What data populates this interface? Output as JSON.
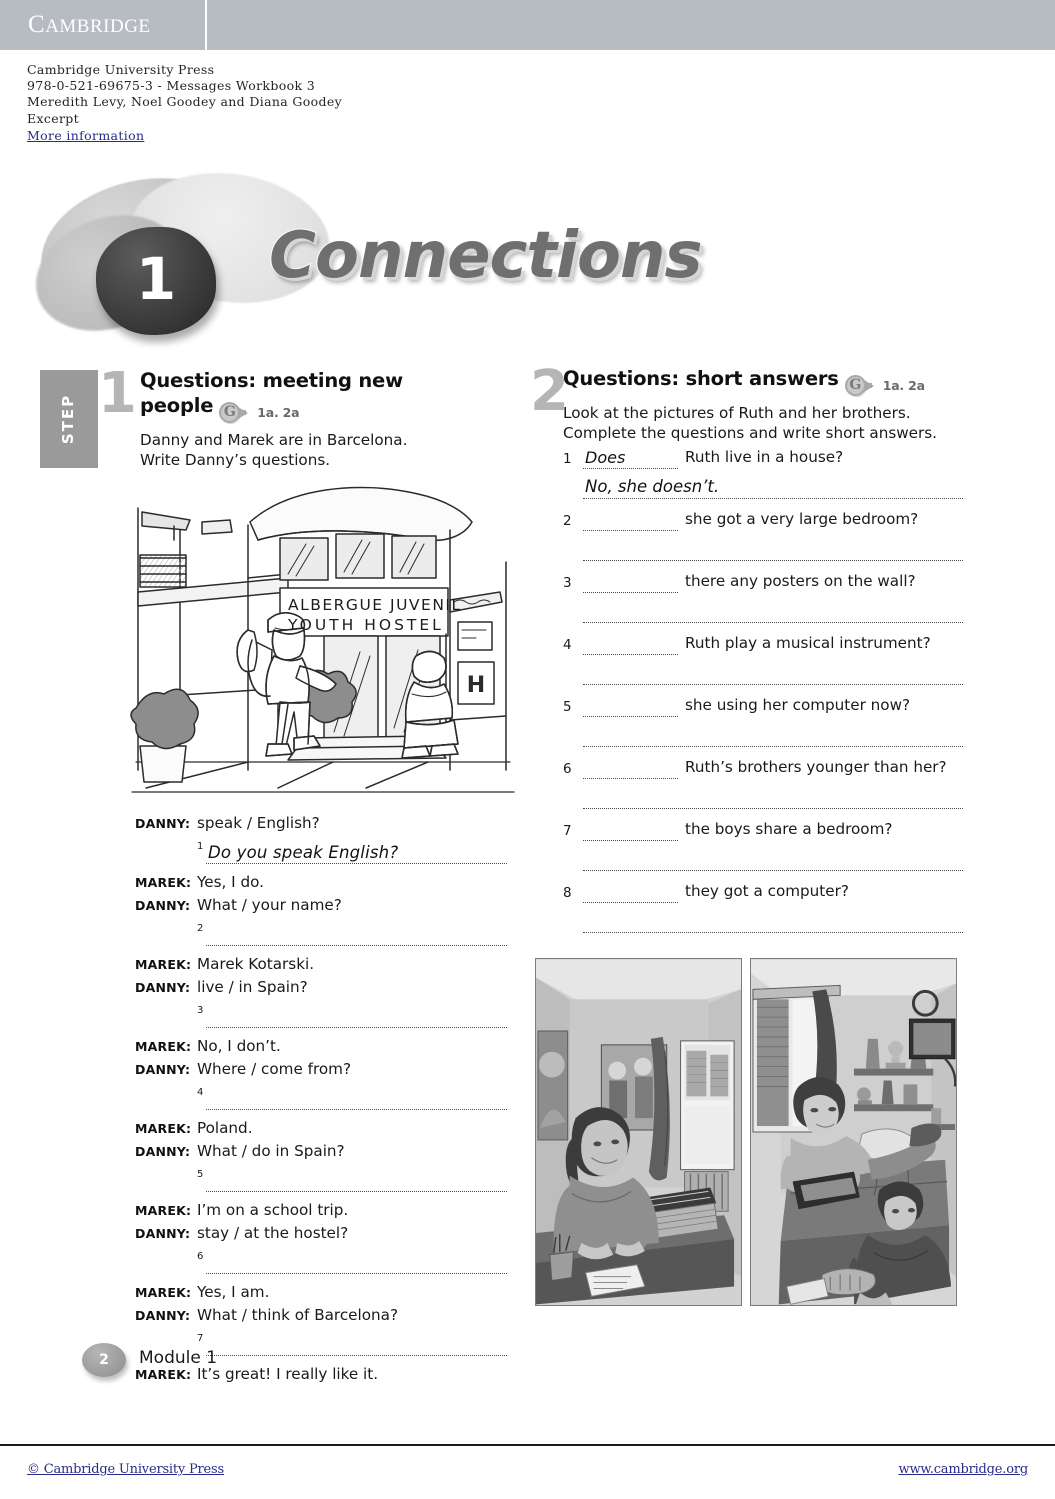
{
  "header": {
    "logo": "CAMBRIDGE",
    "citation_lines": [
      "Cambridge University Press",
      "978-0-521-69675-3 - Messages Workbook 3",
      "Meredith Levy, Noel Goodey and Diana Goodey",
      "Excerpt"
    ],
    "more_information": "More information"
  },
  "banner": {
    "module_number": "1",
    "module_title": "Connections"
  },
  "exercise1": {
    "step_label": "STEP",
    "step_number": "1",
    "number": "1",
    "title": "Questions: meeting new people",
    "gref_letter": "G",
    "gref_text": "1a. 2a",
    "instructions_line1": "Danny and Marek are in Barcelona.",
    "instructions_line2": "Write Danny’s questions.",
    "illustration": {
      "sign_line1": "ALBERGUE JUVENIL",
      "sign_line2": "YOUTH HOSTEL",
      "door_plate": "H"
    },
    "dialogue": [
      {
        "type": "line",
        "speaker": "DANNY:",
        "text": "speak / English?"
      },
      {
        "type": "answer",
        "num": "1",
        "hand": "Do you speak English?"
      },
      {
        "type": "line",
        "speaker": "MAREK:",
        "text": "Yes, I do."
      },
      {
        "type": "line",
        "speaker": "DANNY:",
        "text": "What / your name?"
      },
      {
        "type": "answer",
        "num": "2",
        "hand": ""
      },
      {
        "type": "line",
        "speaker": "MAREK:",
        "text": "Marek Kotarski."
      },
      {
        "type": "line",
        "speaker": "DANNY:",
        "text": "live / in Spain?"
      },
      {
        "type": "answer",
        "num": "3",
        "hand": ""
      },
      {
        "type": "line",
        "speaker": "MAREK:",
        "text": "No, I don’t."
      },
      {
        "type": "line",
        "speaker": "DANNY:",
        "text": "Where / come from?"
      },
      {
        "type": "answer",
        "num": "4",
        "hand": ""
      },
      {
        "type": "line",
        "speaker": "MAREK:",
        "text": "Poland."
      },
      {
        "type": "line",
        "speaker": "DANNY:",
        "text": "What / do in Spain?"
      },
      {
        "type": "answer",
        "num": "5",
        "hand": ""
      },
      {
        "type": "line",
        "speaker": "MAREK:",
        "text": "I’m on a school trip."
      },
      {
        "type": "line",
        "speaker": "DANNY:",
        "text": "stay / at the hostel?"
      },
      {
        "type": "answer",
        "num": "6",
        "hand": ""
      },
      {
        "type": "line",
        "speaker": "MAREK:",
        "text": "Yes, I am."
      },
      {
        "type": "line",
        "speaker": "DANNY:",
        "text": "What / think of Barcelona?"
      },
      {
        "type": "answer",
        "num": "7",
        "hand": ""
      },
      {
        "type": "line",
        "speaker": "MAREK:",
        "text": "It’s great! I really like it."
      }
    ]
  },
  "exercise2": {
    "number": "2",
    "title": "Questions: short answers",
    "gref_letter": "G",
    "gref_text": "1a. 2a",
    "instructions_line1": "Look at the pictures of Ruth and her brothers.",
    "instructions_line2": "Complete the questions and write short answers.",
    "questions": [
      {
        "num": "1",
        "gap": "Does",
        "text": "Ruth live in a house?",
        "answer": "No, she doesn’t."
      },
      {
        "num": "2",
        "gap": "",
        "text": "she got a very large bedroom?",
        "answer": ""
      },
      {
        "num": "3",
        "gap": "",
        "text": "there any posters on the wall?",
        "answer": ""
      },
      {
        "num": "4",
        "gap": "",
        "text": "Ruth play a musical instrument?",
        "answer": ""
      },
      {
        "num": "5",
        "gap": "",
        "text": "she using her computer now?",
        "answer": ""
      },
      {
        "num": "6",
        "gap": "",
        "text": "Ruth’s brothers younger than her?",
        "answer": ""
      },
      {
        "num": "7",
        "gap": "",
        "text": "the boys share a bedroom?",
        "answer": ""
      },
      {
        "num": "8",
        "gap": "",
        "text": "they got a computer?",
        "answer": ""
      }
    ]
  },
  "footer": {
    "page_number": "2",
    "module_label": "Module 1",
    "copyright": "© Cambridge University Press",
    "website": "www.cambridge.org"
  },
  "colors": {
    "topbar": "#b7bcc3",
    "link": "#2a2a8c",
    "grey_tab": "#9a9a9a",
    "grey_numeral": "#b5b5b5"
  }
}
